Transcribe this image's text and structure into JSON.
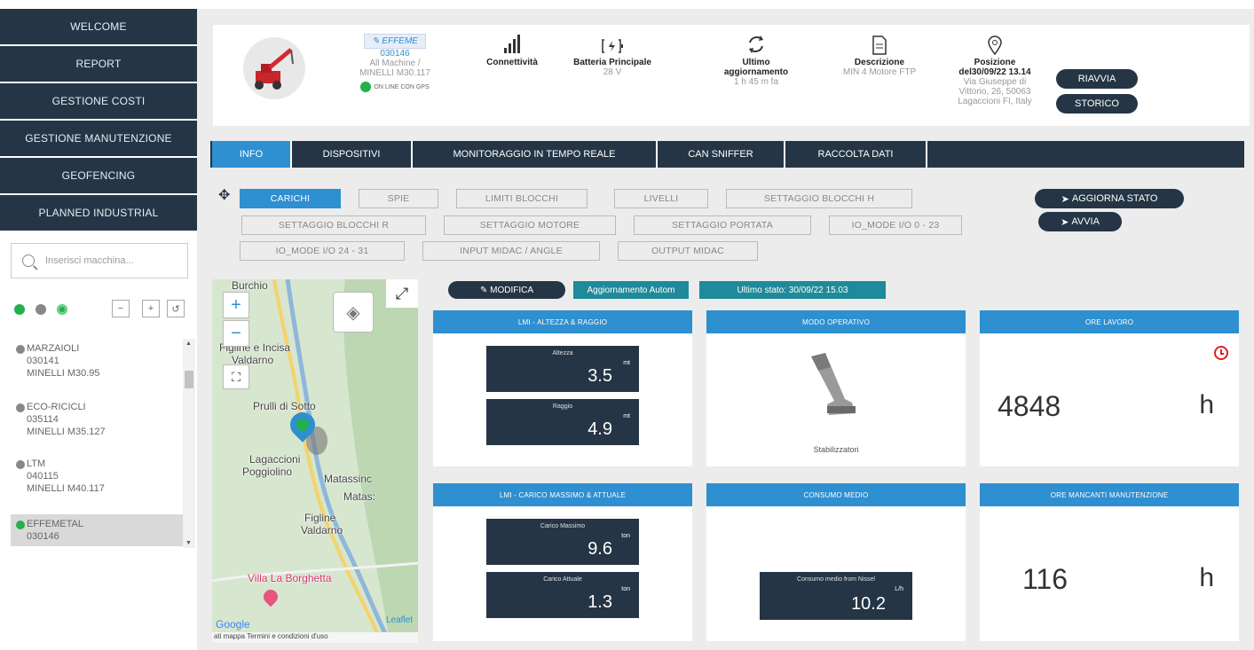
{
  "sidebar": {
    "nav": [
      "WELCOME",
      "REPORT",
      "GESTIONE COSTI",
      "GESTIONE MANUTENZIONE",
      "GEOFENCING",
      "PLANNED INDUSTRIAL"
    ],
    "search_placeholder": "Inserisci macchina...",
    "filters": [
      "green",
      "gray",
      "gps"
    ],
    "controls": [
      "−",
      "+",
      "↺"
    ],
    "machines": [
      {
        "name": "MARZAIOLI",
        "code": "030141",
        "model": "MINELLI M30.95",
        "status": "offline"
      },
      {
        "name": "ECO-RICICLI",
        "code": "035114",
        "model": "MINELLI M35.127",
        "status": "offline"
      },
      {
        "name": "LTM",
        "code": "040115",
        "model": "MINELLI M40.117",
        "status": "offline"
      },
      {
        "name": "EFFEMETAL",
        "code": "030146",
        "model": "",
        "status": "online"
      }
    ]
  },
  "header": {
    "machine_name": "EFFEME",
    "machine_code": "030146",
    "machine_owner": "All Machine /",
    "machine_model": "MINELLI M30.117",
    "status_text": "ON LINE CON GPS",
    "connectivity_label": "Connettività",
    "battery_label": "Batteria Principale",
    "battery_value": "28 V",
    "update_label_1": "Ultimo",
    "update_label_2": "aggiornamento",
    "update_value": "1 h 45 m fa",
    "description_label": "Descrizione",
    "description_value": "MIN 4 Motore FTP",
    "position_label": "Posizione",
    "position_date": "del30/09/22 13.14",
    "address_1": "Via Giuseppe di",
    "address_2": "Vittorio, 26, 50063",
    "address_3": "Lagaccioni FI, Italy",
    "restart_label": "RIAVVIA",
    "history_label": "STORICO"
  },
  "tabs": [
    "INFO",
    "DISPOSITIVI",
    "MONITORAGGIO IN TEMPO REALE",
    "CAN SNIFFER",
    "RACCOLTA DATI"
  ],
  "subtabs": {
    "row1": [
      "CARICHI",
      "SPIE",
      "LIMITI BLOCCHI",
      "LIVELLI",
      "SETTAGGIO BLOCCHI H"
    ],
    "row2": [
      "SETTAGGIO BLOCCHI R",
      "SETTAGGIO MOTORE",
      "SETTAGGIO PORTATA",
      "IO_MODE I/O 0 - 23"
    ],
    "row3": [
      "IO_MODE I/O 24 - 31",
      "INPUT MIDAC / ANGLE",
      "OUTPUT MIDAC"
    ],
    "update_status": "AGGIORNA STATO",
    "start": "AVVIA"
  },
  "map": {
    "labels": [
      "Burchio",
      "Figline e Incisa",
      "Valdarno",
      "Prulli di Sotto",
      "Lagaccioni",
      "Poggiolino",
      "Matassinc",
      "Matas:",
      "Figline",
      "Valdarno",
      "Villa La Borghetta"
    ],
    "zoom_in": "+",
    "zoom_out": "−",
    "attribution": "Leaflet",
    "google": "Google",
    "footer": "ati mappa  Termini e condizioni d'uso"
  },
  "realtime": {
    "edit_label": "MODIFICA",
    "auto_update_label": "Aggiornamento Autom",
    "last_state_label": "Ultimo stato: 30/09/22 15.03"
  },
  "cards": {
    "lmi_title": "LMI - ALTEZZA & RAGGIO",
    "height_label": "Altezza",
    "height_value": "3.5",
    "height_unit": "mt",
    "radius_label": "Raggio",
    "radius_value": "4.9",
    "radius_unit": "mt",
    "mode_title": "MODO OPERATIVO",
    "mode_value": "Stabilizzatori",
    "hours_title": "ORE LAVORO",
    "hours_value": "4848",
    "hours_unit": "h",
    "load_title": "LMI - CARICO MASSIMO & ATTUALE",
    "max_load_label": "Carico Massimo",
    "max_load_value": "9.6",
    "max_load_unit": "ton",
    "cur_load_label": "Carico Attuale",
    "cur_load_value": "1.3",
    "cur_load_unit": "ton",
    "consumption_title": "CONSUMO MEDIO",
    "consumption_label": "Consumo medio from Nissel",
    "consumption_value": "10.2",
    "consumption_unit": "L/h",
    "maint_title": "ORE MANCANTI MANUTENZIONE",
    "maint_value": "116",
    "maint_unit": "h"
  },
  "colors": {
    "navy": "#253545",
    "accent": "#2e8fd1",
    "online": "#22b14c",
    "alert": "#e02020"
  }
}
